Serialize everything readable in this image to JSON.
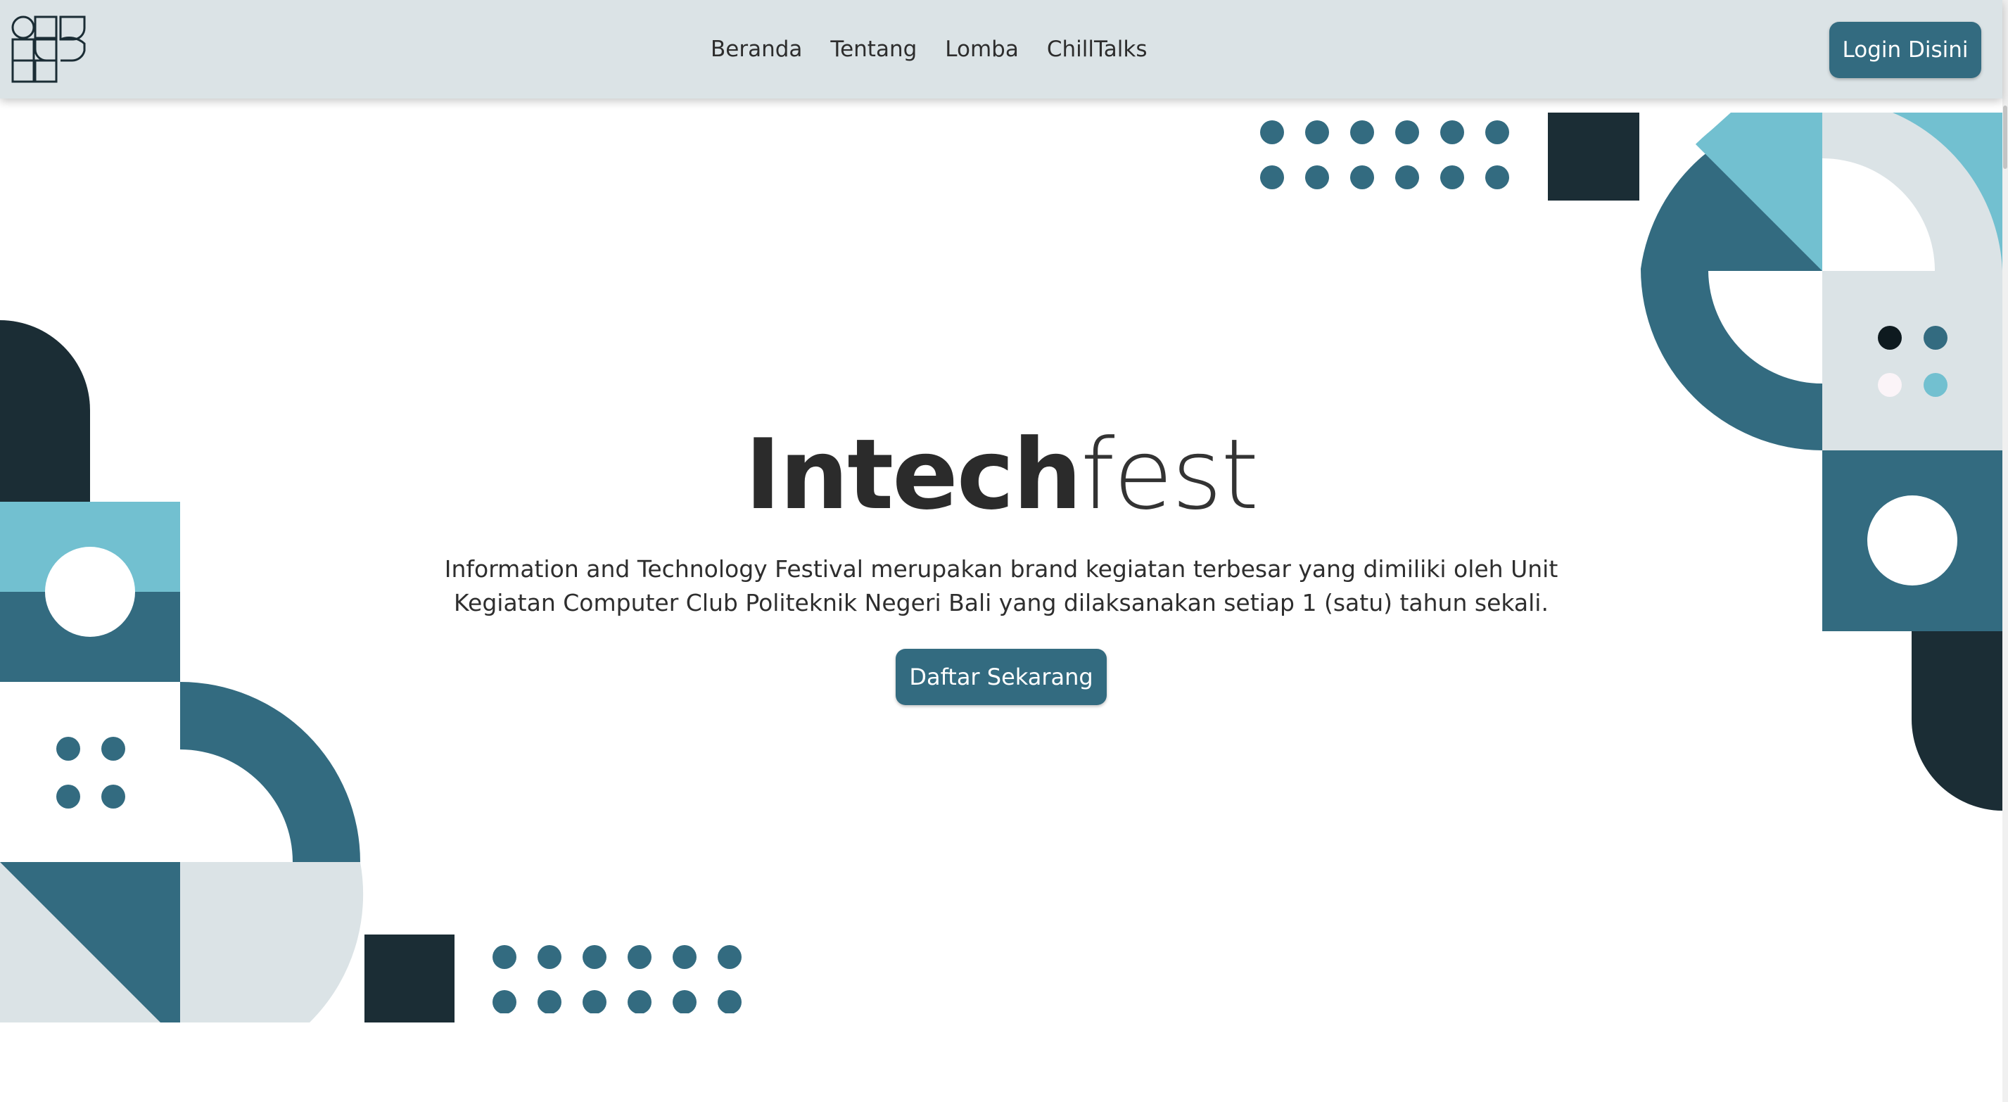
{
  "nav": {
    "logo": "intechfest-logo",
    "links": [
      "Beranda",
      "Tentang",
      "Lomba",
      "ChillTalks"
    ],
    "login_label": "Login Disini"
  },
  "hero": {
    "title_bold": "Intech",
    "title_light": "fest",
    "description": "Information and Technology Festival merupakan brand kegiatan terbesar yang dimiliki oleh Unit Kegiatan Computer Club Politeknik Negeri Bali yang dilaksanakan setiap 1 (satu) tahun sekali.",
    "cta_label": "Daftar Sekarang"
  },
  "colors": {
    "teal": "#336b80",
    "light_teal": "#72c0d0",
    "dark": "#1b2d35",
    "pale": "#dbe3e6",
    "navbar_bg": "#dbe3e6"
  }
}
